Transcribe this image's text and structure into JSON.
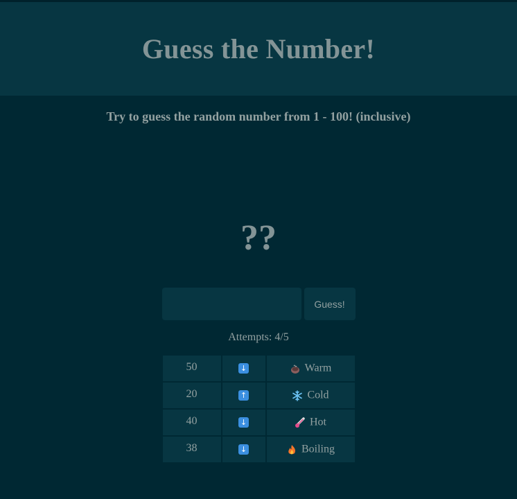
{
  "header": {
    "title": "Guess the Number!"
  },
  "instructions": "Try to guess the random number from 1 - 100! (inclusive)",
  "mystery": "??",
  "form": {
    "input_value": "",
    "input_placeholder": "",
    "button_label": "Guess!"
  },
  "attempts": "Attempts: 4/5",
  "history": [
    {
      "guess": "50",
      "direction_icon": "down-arrow-icon",
      "temperature_icon": "warm-icon",
      "temperature": "Warm"
    },
    {
      "guess": "20",
      "direction_icon": "up-arrow-icon",
      "temperature_icon": "snowflake-icon",
      "temperature": "Cold"
    },
    {
      "guess": "40",
      "direction_icon": "down-arrow-icon",
      "temperature_icon": "thermometer-icon",
      "temperature": "Hot"
    },
    {
      "guess": "38",
      "direction_icon": "down-arrow-icon",
      "temperature_icon": "fire-icon",
      "temperature": "Boiling"
    }
  ],
  "colors": {
    "background": "#002833",
    "panel": "#073642",
    "text": "#93a1a1",
    "arrow": "#3b8fe0"
  }
}
